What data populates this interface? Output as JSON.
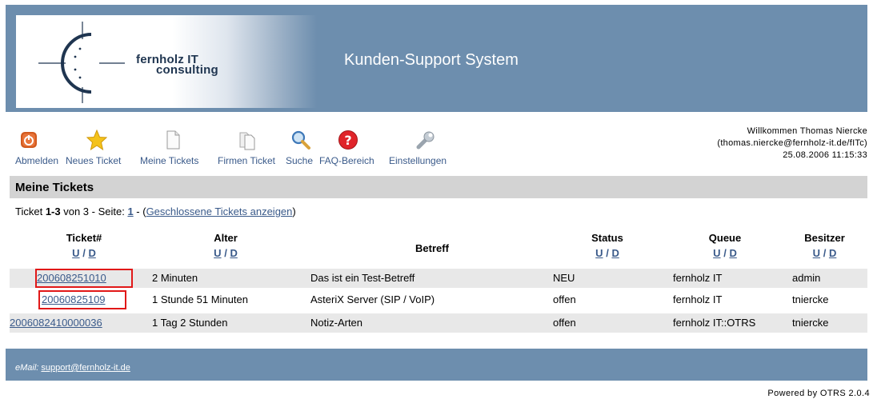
{
  "header": {
    "logo_line1": "fernholz IT",
    "logo_line2": "consulting",
    "title": "Kunden-Support System"
  },
  "toolbar": {
    "items": [
      {
        "label": "Abmelden",
        "icon": "logout-icon"
      },
      {
        "label": "Neues Ticket",
        "icon": "star-icon"
      },
      {
        "label": "Meine Tickets",
        "icon": "document-icon"
      },
      {
        "label": "Firmen Ticket",
        "icon": "documents-icon"
      },
      {
        "label": "Suche",
        "icon": "search-icon"
      },
      {
        "label": "FAQ-Bereich",
        "icon": "help-icon"
      },
      {
        "label": "Einstellungen",
        "icon": "wrench-icon"
      }
    ]
  },
  "welcome": {
    "line1": "Willkommen Thomas Niercke",
    "line2": "(thomas.niercke@fernholz-it.de/fITc)",
    "line3": "25.08.2006 11:15:33"
  },
  "section": {
    "title": "Meine Tickets"
  },
  "summary": {
    "prefix": "Ticket ",
    "range": "1-3",
    "middle": " von 3 - Seite: ",
    "page": "1",
    "dash": " - (",
    "closed_link": "Geschlossene Tickets anzeigen",
    "suffix": ")"
  },
  "table": {
    "columns": [
      {
        "label": "Ticket#",
        "sortable": true
      },
      {
        "label": "Alter",
        "sortable": true
      },
      {
        "label": "Betreff",
        "sortable": false
      },
      {
        "label": "Status",
        "sortable": true
      },
      {
        "label": "Queue",
        "sortable": true
      },
      {
        "label": "Besitzer",
        "sortable": true
      }
    ],
    "sort_up": "U",
    "sort_sep": "/",
    "sort_down": "D",
    "rows": [
      {
        "ticket": "200608251010",
        "age": "2 Minuten",
        "subject": "Das ist ein Test-Betreff",
        "status": "NEU",
        "queue": "fernholz IT",
        "owner": "admin"
      },
      {
        "ticket": "20060825109",
        "age": "1 Stunde 51 Minuten",
        "subject": "AsteriX Server (SIP / VoIP)",
        "status": "offen",
        "queue": "fernholz IT",
        "owner": "tniercke"
      },
      {
        "ticket": "2006082410000036",
        "age": "1 Tag 2 Stunden",
        "subject": "Notiz-Arten",
        "status": "offen",
        "queue": "fernholz IT::OTRS",
        "owner": "tniercke"
      }
    ]
  },
  "footer": {
    "label": "eMail: ",
    "email": "support@fernholz-it.de",
    "powered": "Powered by OTRS 2.0.4"
  },
  "colors": {
    "header_bg": "#6d8eae",
    "link": "#3a5a8a",
    "section_bg": "#d3d3d3",
    "row_shade": "#e8e8e8",
    "highlight": "#e11818"
  }
}
